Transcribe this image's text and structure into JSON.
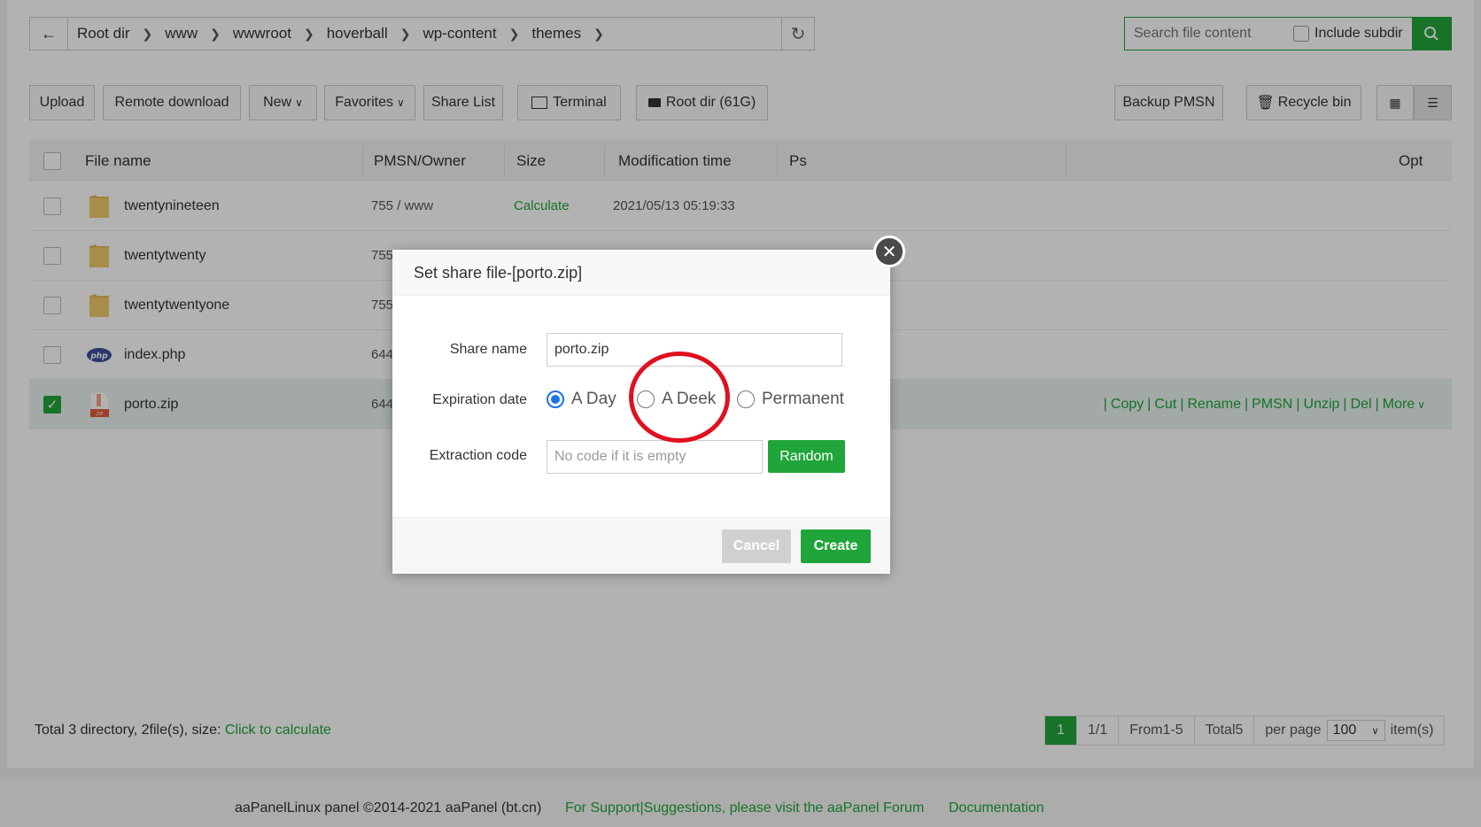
{
  "path": {
    "crumbs": [
      "Root dir",
      "www",
      "wwwroot",
      "hoverball",
      "wp-content",
      "themes"
    ]
  },
  "search": {
    "placeholder": "Search file content",
    "subdir_label": "Include subdir"
  },
  "toolbar": {
    "upload": "Upload",
    "remote_download": "Remote download",
    "new": "New",
    "favorites": "Favorites",
    "share_list": "Share List",
    "terminal": "Terminal",
    "root_dir": "Root dir (61G)",
    "backup_pmsn": "Backup PMSN",
    "recycle_bin": "Recycle bin"
  },
  "table": {
    "headers": {
      "file_name": "File name",
      "owner": "PMSN/Owner",
      "size": "Size",
      "mtime": "Modification time",
      "ps": "Ps",
      "opt": "Opt"
    },
    "rows": [
      {
        "name": "twentynineteen",
        "perm": "755 / www",
        "size": "Calculate",
        "mtime": "2021/05/13 05:19:33",
        "type": "folder"
      },
      {
        "name": "twentytwenty",
        "perm": "755",
        "type": "folder"
      },
      {
        "name": "twentytwentyone",
        "perm": "755",
        "type": "folder"
      },
      {
        "name": "index.php",
        "perm": "644",
        "type": "php"
      },
      {
        "name": "porto.zip",
        "perm": "644",
        "type": "zip",
        "selected": true
      }
    ],
    "ops": [
      "Copy",
      "Cut",
      "Rename",
      "PMSN",
      "Unzip",
      "Del",
      "More"
    ]
  },
  "summary": {
    "text": "Total 3 directory, 2file(s), size:",
    "link": "Click to calculate"
  },
  "pager": {
    "current": "1",
    "pages": "1/1",
    "range": "From1-5",
    "total": "Total5",
    "per_page_label": "per page",
    "per_page_value": "100",
    "items_label": "item(s)"
  },
  "footer": {
    "copyright": "aaPanelLinux panel ©2014-2021 aaPanel (bt.cn)",
    "support": "For Support|Suggestions, please visit the aaPanel Forum",
    "docs": "Documentation"
  },
  "modal": {
    "title": "Set share file-[porto.zip]",
    "share_name_label": "Share name",
    "share_name_value": "porto.zip",
    "expiration_label": "Expiration date",
    "options": [
      "A Day",
      "A Deek",
      "Permanent"
    ],
    "selected_option": "A Day",
    "extraction_label": "Extraction code",
    "extraction_placeholder": "No code if it is empty",
    "random_button": "Random",
    "cancel_button": "Cancel",
    "create_button": "Create"
  },
  "colors": {
    "accent": "#20a53a",
    "annotation": "#e01020",
    "radio_selected": "#1a73e8"
  }
}
